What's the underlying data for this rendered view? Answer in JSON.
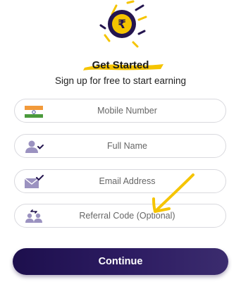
{
  "header": {
    "logo_icon": "rupee-coin-icon",
    "title": "Get Started",
    "subtitle": "Sign up for free to start earning"
  },
  "form": {
    "mobile": {
      "placeholder": "Mobile Number",
      "icon": "india-flag-icon"
    },
    "name": {
      "placeholder": "Full Name",
      "icon": "user-check-icon"
    },
    "email": {
      "placeholder": "Email Address",
      "icon": "envelope-check-icon"
    },
    "referral": {
      "placeholder": "Referral Code (Optional)",
      "icon": "referral-users-icon"
    }
  },
  "annotation": {
    "icon": "hand-drawn-arrow-icon",
    "color": "#f5c400"
  },
  "actions": {
    "continue_label": "Continue"
  },
  "colors": {
    "accent": "#f5c400",
    "brand_dark": "#24154f"
  }
}
